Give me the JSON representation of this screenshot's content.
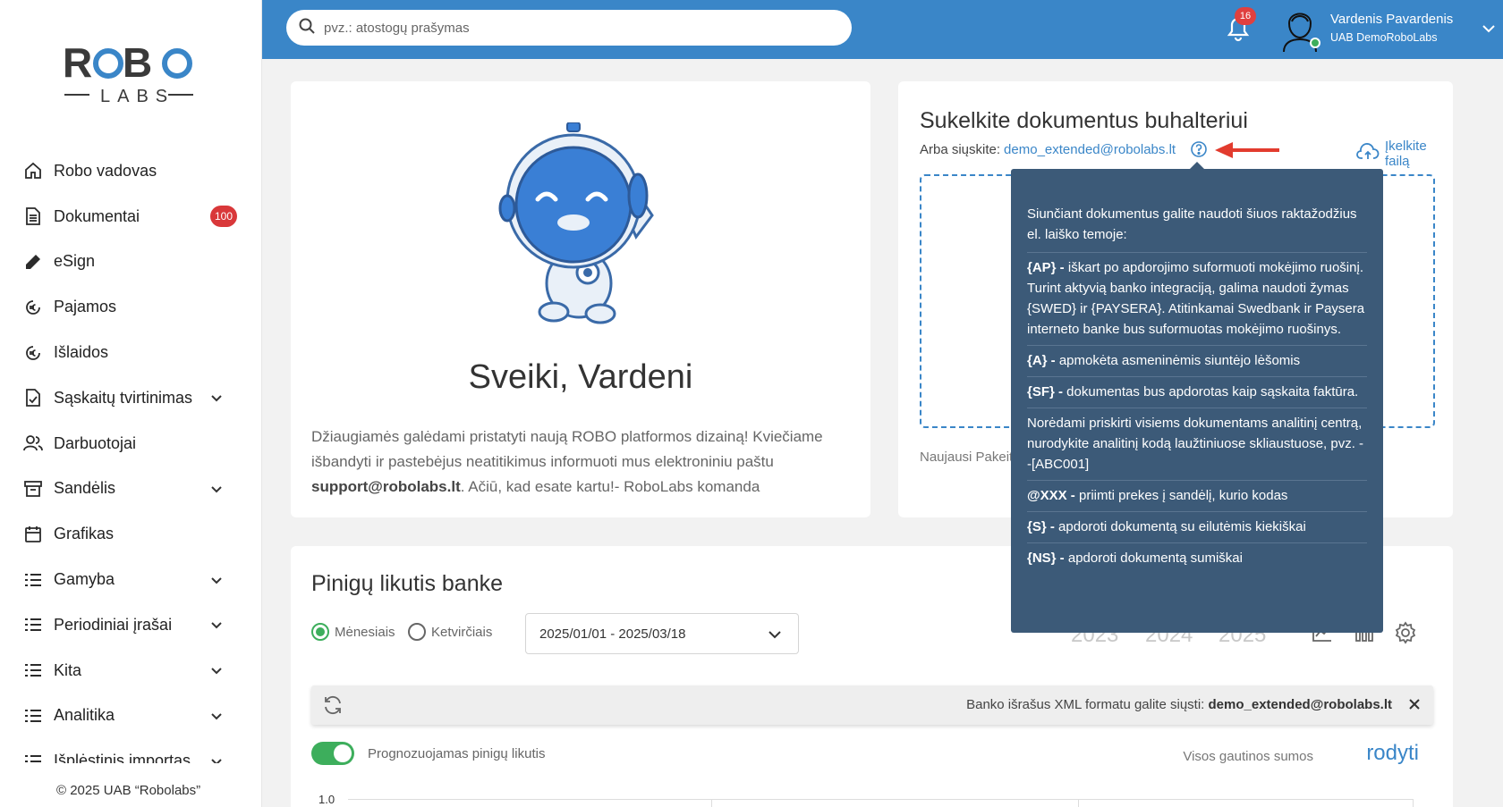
{
  "sidebar": {
    "logo_top": "ROBO",
    "logo_bottom": "LABS",
    "items": [
      {
        "label": "Robo vadovas",
        "icon": "home-icon",
        "chevron": false
      },
      {
        "label": "Dokumentai",
        "icon": "document-icon",
        "chevron": false,
        "badge": "100"
      },
      {
        "label": "eSign",
        "icon": "pen-icon",
        "chevron": false
      },
      {
        "label": "Pajamos",
        "icon": "euro-circle-icon",
        "chevron": false
      },
      {
        "label": "Išlaidos",
        "icon": "euro-circle-icon",
        "chevron": false
      },
      {
        "label": "Sąskaitų tvirtinimas",
        "icon": "document-check-icon",
        "chevron": true
      },
      {
        "label": "Darbuotojai",
        "icon": "users-icon",
        "chevron": false
      },
      {
        "label": "Sandėlis",
        "icon": "archive-icon",
        "chevron": true
      },
      {
        "label": "Grafikas",
        "icon": "calendar-icon",
        "chevron": false
      },
      {
        "label": "Gamyba",
        "icon": "list-icon",
        "chevron": true
      },
      {
        "label": "Periodiniai įrašai",
        "icon": "list-icon",
        "chevron": true
      },
      {
        "label": "Kita",
        "icon": "list-icon",
        "chevron": true
      },
      {
        "label": "Analitika",
        "icon": "list-icon",
        "chevron": true
      },
      {
        "label": "Išplėstinis importas",
        "icon": "list-icon",
        "chevron": true
      }
    ],
    "copyright": "© 2025 UAB “Robolabs”"
  },
  "header": {
    "search_placeholder": "pvz.: atostogų prašymas",
    "notifications_count": "16",
    "user_name": "Vardenis Pavardenis",
    "user_company": "UAB DemoRoboLabs"
  },
  "welcome": {
    "title": "Sveiki, Vardeni",
    "text_1": "Džiaugiamės galėdami pristatyti naują ROBO platformos dizainą! Kviečiame išbandyti ir pastebėjus neatitikimus informuoti mus elektroniniu paštu ",
    "email": "support@robolabs.lt",
    "text_2": ". Ačiū, kad esate kartu!- RoboLabs komanda"
  },
  "upload": {
    "title": "Sukelkite dokumentus buhalteriui",
    "send_label": "Arba siųskite:",
    "send_email": "demo_extended@robolabs.lt",
    "upload_link": "Įkelkite failą",
    "dropzone_text": "Įkelkite failą",
    "latest_label": "Naujausi Pakeit"
  },
  "tooltip": {
    "intro": "Siunčiant dokumentus galite naudoti šiuos raktažodžius el. laiško temoje:",
    "items": [
      {
        "key": "{AP} -",
        "text": " iškart po apdorojimo suformuoti mokėjimo ruošinį. Turint aktyvią banko integraciją, galima naudoti žymas {SWED} ir {PAYSERA}. Atitinkamai Swedbank ir Paysera interneto banke bus suformuotas mokėjimo ruošinys."
      },
      {
        "key": "{A} -",
        "text": " apmokėta asmeninėmis siuntėjo lėšomis"
      },
      {
        "key": "{SF} -",
        "text": " dokumentas bus apdorotas kaip sąskaita faktūra."
      },
      {
        "key": "",
        "text": "Norėdami priskirti visiems dokumentams analitinį centrą, nurodykite analitinį kodą laužtiniuose skliaustuose, pvz. --[ABC001]"
      },
      {
        "key": "@XXX -",
        "text": " priimti prekes į sandėlį, kurio kodas"
      },
      {
        "key": "{S} -",
        "text": " apdoroti dokumentą su eilutėmis kiekiškai"
      },
      {
        "key": "{NS} -",
        "text": " apdoroti dokumentą sumiškai"
      }
    ]
  },
  "bank": {
    "title": "Pinigų likutis banke",
    "radio_monthly": "Mėnesiais",
    "radio_quarterly": "Ketvirčiais",
    "date_range": "2025/01/01 - 2025/03/18",
    "years": [
      "2023",
      "2024",
      "2025"
    ],
    "info_text": "Banko išrašus XML formatu galite siųsti: ",
    "info_email": "demo_extended@robolabs.lt",
    "toggle_label": "Prognozuojamas pinigų likutis",
    "sums_label": "Visos gautinos sumos",
    "show_link": "rodyti",
    "axis_top": "1.0"
  },
  "colors": {
    "accent": "#3a86c8",
    "tooltip_bg": "#3c5a78",
    "success": "#3dae5c",
    "badge": "#d9383a"
  }
}
